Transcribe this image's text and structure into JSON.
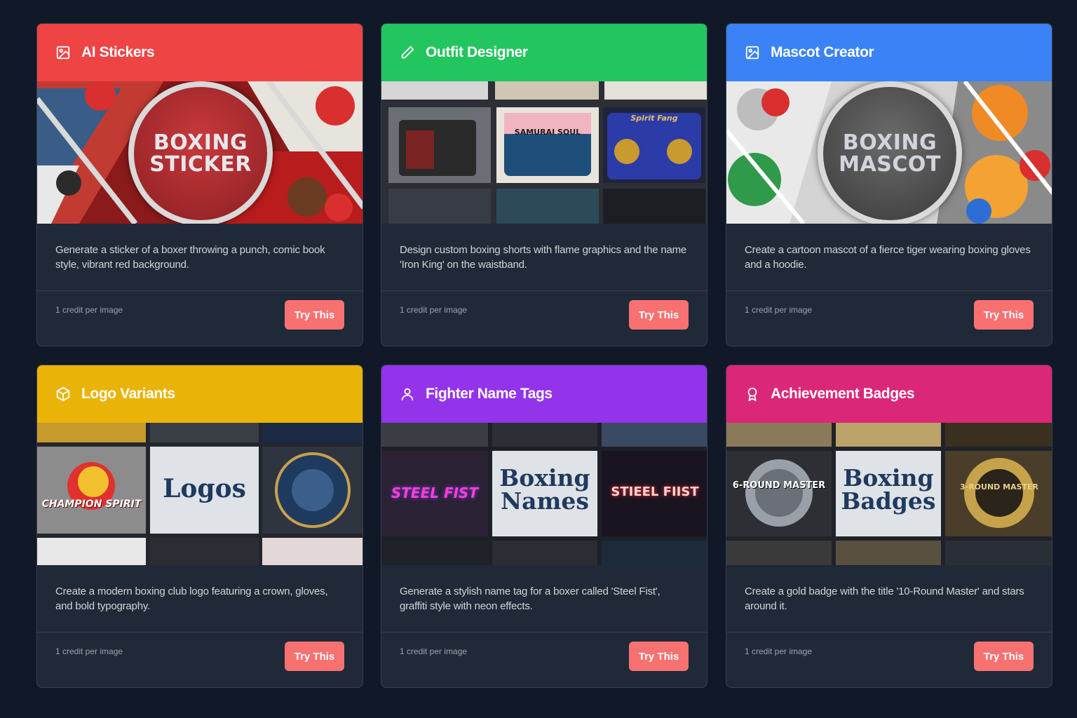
{
  "cards": [
    {
      "title": "AI Stickers",
      "icon": "image-icon",
      "header_color": "#ef4444",
      "image_text": [
        "BOXING",
        "STICKER"
      ],
      "description": "Generate a sticker of a boxer throwing a punch, comic book style, vibrant red background.",
      "credit": "1 credit per image",
      "button": "Try This"
    },
    {
      "title": "Outfit Designer",
      "icon": "pencil-icon",
      "header_color": "#22c55e",
      "image_labels": [
        "SAMURAI SOUL",
        "Spirit Fang"
      ],
      "description": "Design custom boxing shorts with flame graphics and the name 'Iron King' on the waistband.",
      "credit": "1 credit per image",
      "button": "Try This"
    },
    {
      "title": "Mascot Creator",
      "icon": "image-icon",
      "header_color": "#3b82f6",
      "image_text": [
        "BOXING",
        "MASCOT"
      ],
      "description": "Create a cartoon mascot of a fierce tiger wearing boxing gloves and a hoodie.",
      "credit": "1 credit per image",
      "button": "Try This"
    },
    {
      "title": "Logo Variants",
      "icon": "cube-icon",
      "header_color": "#eab308",
      "image_text": [
        "Logos"
      ],
      "image_labels": [
        "CHAMPION SPIRIT"
      ],
      "description": "Create a modern boxing club logo featuring a crown, gloves, and bold typography.",
      "credit": "1 credit per image",
      "button": "Try This"
    },
    {
      "title": "Fighter Name Tags",
      "icon": "user-icon",
      "header_color": "#9333ea",
      "image_text": [
        "Boxing",
        "Names"
      ],
      "image_labels": [
        "STEEL FIST",
        "STIEEL FIIST"
      ],
      "description": "Generate a stylish name tag for a boxer called 'Steel Fist', graffiti style with neon effects.",
      "credit": "1 credit per image",
      "button": "Try This"
    },
    {
      "title": "Achievement Badges",
      "icon": "award-icon",
      "header_color": "#db2777",
      "image_text": [
        "Boxing",
        "Badges"
      ],
      "image_labels": [
        "6-ROUND MASTER",
        "3-ROUND MASTER"
      ],
      "description": "Create a gold badge with the title '10-Round Master' and stars around it.",
      "credit": "1 credit per image",
      "button": "Try This"
    }
  ]
}
